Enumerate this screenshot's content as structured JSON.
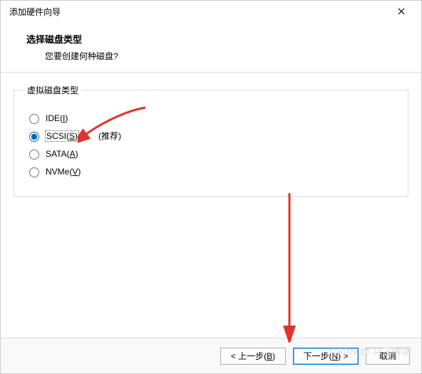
{
  "window": {
    "title": "添加硬件向导"
  },
  "header": {
    "heading": "选择磁盘类型",
    "subtext": "您要创建何种磁盘?"
  },
  "group": {
    "legend": "虚拟磁盘类型",
    "options": {
      "ide": {
        "label_pre": "IDE(",
        "accel": "I",
        "label_post": ")"
      },
      "scsi": {
        "label_pre": "SCSI(",
        "accel": "S",
        "label_post": ")",
        "recommend": "(推荐)"
      },
      "sata": {
        "label_pre": "SATA(",
        "accel": "A",
        "label_post": ")"
      },
      "nvme": {
        "label_pre": "NVMe(",
        "accel": "V",
        "label_post": ")"
      }
    }
  },
  "footer": {
    "back": {
      "lt": "< 上一步(",
      "accel": "B",
      "gt": ")"
    },
    "next": {
      "lt": "下一步(",
      "accel": "N",
      "gt": ") >"
    },
    "cancel": {
      "label": "取消"
    }
  },
  "watermark": "CSDN @ 月三清酒"
}
